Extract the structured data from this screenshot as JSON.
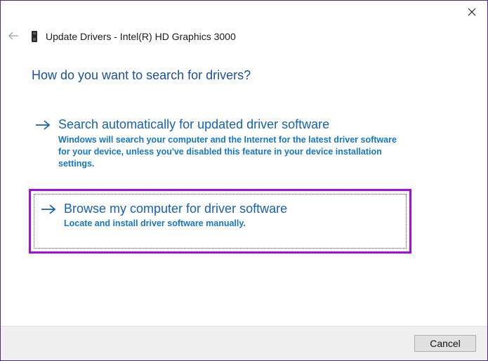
{
  "window": {
    "title": "Update Drivers - Intel(R) HD Graphics 3000",
    "close_label": "✕",
    "back_label": "←"
  },
  "main": {
    "heading": "How do you want to search for drivers?",
    "options": [
      {
        "title": "Search automatically for updated driver software",
        "description": "Windows will search your computer and the Internet for the latest driver software for your device, unless you've disabled this feature in your device installation settings."
      },
      {
        "title": "Browse my computer for driver software",
        "description": "Locate and install driver software manually."
      }
    ]
  },
  "footer": {
    "cancel_label": "Cancel"
  },
  "colors": {
    "heading": "#1c4fa0",
    "link": "#1561b8",
    "description": "#1577c7",
    "highlight_border": "#a20fe0",
    "window_border": "#4b2a85"
  },
  "icons": {
    "close": "close-icon",
    "back": "back-arrow-icon",
    "device": "device-icon",
    "option_arrow": "arrow-right-icon"
  }
}
